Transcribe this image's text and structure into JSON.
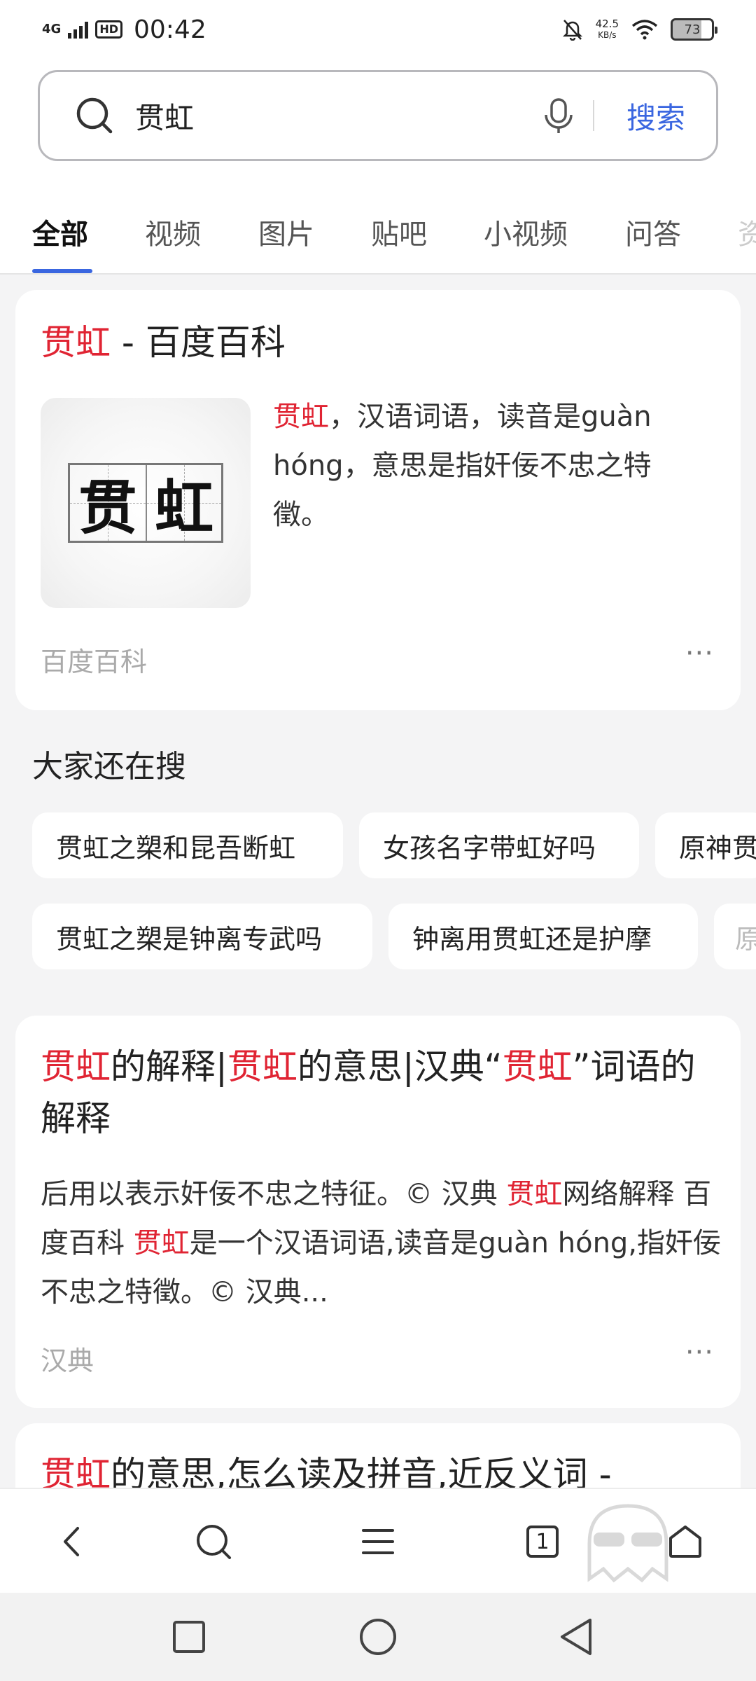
{
  "status_bar": {
    "network": "4G",
    "hd": "HD",
    "time": "00:42",
    "speed_value": "42.5",
    "speed_unit": "KB/s",
    "battery": "73"
  },
  "search": {
    "query": "贯虹",
    "button_label": "搜索"
  },
  "tabs": [
    {
      "label": "全部",
      "active": true
    },
    {
      "label": "视频"
    },
    {
      "label": "图片"
    },
    {
      "label": "贴吧"
    },
    {
      "label": "小视频"
    },
    {
      "label": "问答"
    },
    {
      "label": "资"
    }
  ],
  "result1": {
    "title_highlight": "贯虹",
    "title_rest": " - 百度百科",
    "image_chars": [
      "贯",
      "虹"
    ],
    "abstract_highlight": "贯虹",
    "abstract_rest": "，汉语词语，读音是guàn hóng，意思是指奸佞不忠之特徵。",
    "source": "百度百科",
    "more": "···"
  },
  "related": {
    "title": "大家还在搜",
    "row1": [
      "贯虹之槊和昆吾断虹",
      "女孩名字带虹好吗",
      "原神贯"
    ],
    "row2": [
      "贯虹之槊是钟离专武吗",
      "钟离用贯虹还是护摩",
      "原"
    ]
  },
  "result2": {
    "title_parts": [
      {
        "text": "贯虹",
        "hl": true
      },
      {
        "text": "的解释|",
        "hl": false
      },
      {
        "text": "贯虹",
        "hl": true
      },
      {
        "text": "的意思|汉典“",
        "hl": false
      },
      {
        "text": "贯虹",
        "hl": true
      },
      {
        "text": "”词语的解释",
        "hl": false
      }
    ],
    "abstract_parts": [
      {
        "text": "后用以表示奸佞不忠之特征。© 汉典 ",
        "hl": false
      },
      {
        "text": "贯虹",
        "hl": true
      },
      {
        "text": "网络解释 百度百科 ",
        "hl": false
      },
      {
        "text": "贯虹",
        "hl": true
      },
      {
        "text": "是一个汉语词语,读音是guàn hóng,指奸佞不忠之特徵。© 汉典...",
        "hl": false
      }
    ],
    "source": "汉典",
    "more": "···"
  },
  "result3": {
    "title_highlight": "贯虹",
    "title_rest": "的意思,怎么读及拼音,近反义词 -"
  },
  "browser_bar": {
    "tab_count": "1"
  }
}
